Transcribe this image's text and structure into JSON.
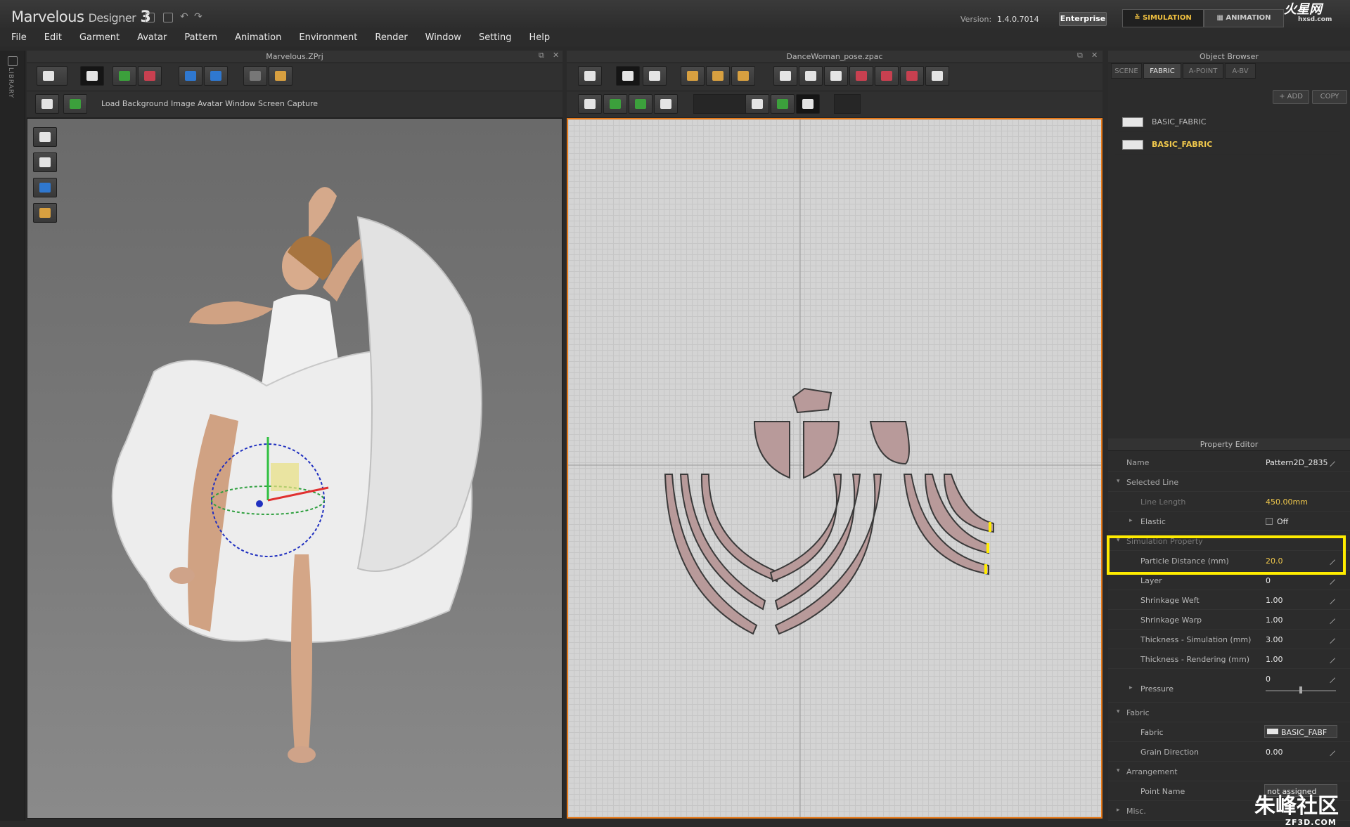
{
  "app": {
    "logo_word": "Marvelous",
    "logo_suffix": "Designer",
    "logo_version": "3",
    "version_label": "Version:",
    "version_number": "1.4.0.7014",
    "edition": "Enterprise",
    "mode_simulation": "SIMULATION",
    "mode_animation": "ANIMATION"
  },
  "menu": [
    "File",
    "Edit",
    "Garment",
    "Avatar",
    "Pattern",
    "Animation",
    "Environment",
    "Render",
    "Window",
    "Setting",
    "Help"
  ],
  "sidebar": {
    "label": "LIBRARY"
  },
  "left_panel": {
    "title": "Marvelous.ZPrj",
    "toolbar_text": "Load Background Image Avatar Window Screen Capture"
  },
  "mid_panel": {
    "title": "DanceWoman_pose.zpac"
  },
  "object_browser": {
    "title": "Object Browser",
    "tabs": [
      "SCENE",
      "FABRIC",
      "A-POINT",
      "A-BV"
    ],
    "active_tab": "FABRIC",
    "add_label": "ADD",
    "copy_label": "COPY",
    "fabrics": [
      "BASIC_FABRIC",
      "BASIC_FABRIC"
    ],
    "selected_index": 1
  },
  "property_editor": {
    "title": "Property Editor",
    "name_label": "Name",
    "name_value": "Pattern2D_2835",
    "selected_line_group": "Selected Line",
    "line_length_label": "Line Length",
    "line_length_value": "450.00mm",
    "elastic_label": "Elastic",
    "elastic_value": "Off",
    "simulation_group": "Simulation Property",
    "particle_distance_label": "Particle Distance (mm)",
    "particle_distance_value": "20.0",
    "layer_label": "Layer",
    "layer_value": "0",
    "shrinkage_weft_label": "Shrinkage Weft",
    "shrinkage_weft_value": "1.00",
    "shrinkage_warp_label": "Shrinkage Warp",
    "shrinkage_warp_value": "1.00",
    "thickness_sim_label": "Thickness - Simulation (mm)",
    "thickness_sim_value": "3.00",
    "thickness_render_label": "Thickness - Rendering (mm)",
    "thickness_render_value": "1.00",
    "pressure_label": "Pressure",
    "pressure_value": "0",
    "fabric_group": "Fabric",
    "fabric_label": "Fabric",
    "fabric_value": "BASIC_FABF",
    "grain_label": "Grain Direction",
    "grain_value": "0.00",
    "arrangement_group": "Arrangement",
    "point_name_label": "Point Name",
    "point_name_value": "not assigned",
    "misc_group": "Misc."
  },
  "watermarks": {
    "top_brand": "火星网",
    "top_site": "hxsd.com",
    "bottom_brand": "朱峰社区",
    "bottom_site": "ZF3D.COM"
  },
  "colors": {
    "accent_orange": "#e77a1a",
    "highlight_yellow": "#ffec00",
    "selected_text": "#f0c84c",
    "pattern_fill": "#b89a9a"
  }
}
